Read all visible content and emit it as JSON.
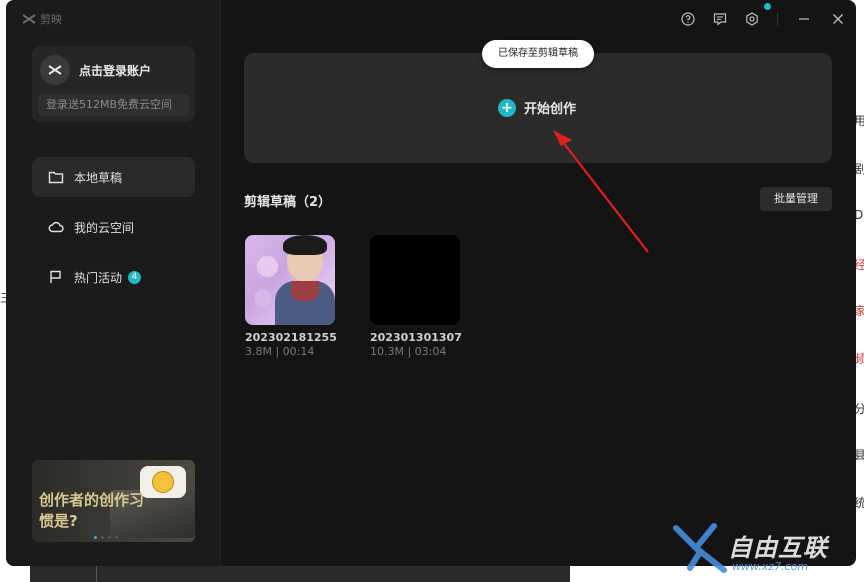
{
  "app": {
    "logo_text": "剪映"
  },
  "account": {
    "login_label": "点击登录账户",
    "cloud_promo": "登录送512MB免费云空间"
  },
  "sidebar": {
    "items": [
      {
        "label": "本地草稿",
        "icon": "folder-icon",
        "active": true
      },
      {
        "label": "我的云空间",
        "icon": "cloud-icon",
        "active": false
      },
      {
        "label": "热门活动",
        "icon": "flag-icon",
        "active": false,
        "badge": "4"
      }
    ]
  },
  "promo": {
    "text": "创作者的创作习惯是?"
  },
  "titlebar": {
    "icons": [
      "help-icon",
      "feedback-icon",
      "settings-icon",
      "minimize-icon",
      "close-icon"
    ]
  },
  "main": {
    "toast": "已保存至剪辑草稿",
    "create_label": "开始创作",
    "section_title": "剪辑草稿（2）",
    "batch_label": "批量管理",
    "drafts": [
      {
        "name": "202302181255",
        "meta": "3.8M | 00:14"
      },
      {
        "name": "202301301307",
        "meta": "10.3M | 03:04"
      }
    ]
  },
  "watermark": {
    "text": "自由互联",
    "url": "www.xz7.com"
  },
  "colors": {
    "accent": "#1fb8c3",
    "window_bg": "#141414",
    "sidebar_bg": "#1b1b1b",
    "annotation_arrow": "#e0201b"
  }
}
